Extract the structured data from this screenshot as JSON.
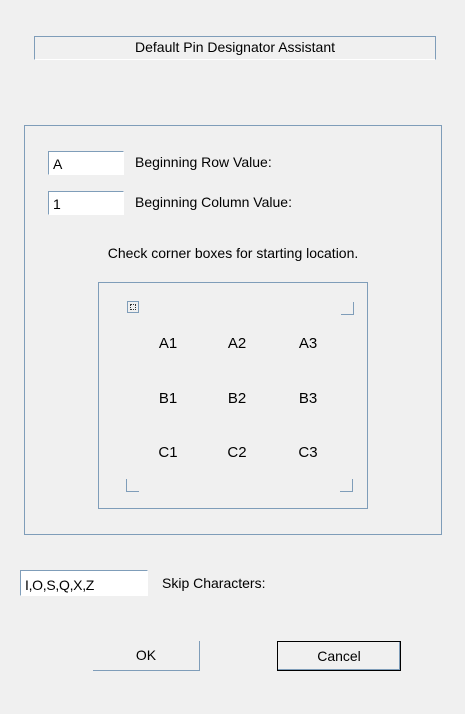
{
  "dialog": {
    "title": "Default Pin Designator Assistant"
  },
  "fields": {
    "row": {
      "label": "Beginning Row Value:",
      "value": "A"
    },
    "column": {
      "label": "Beginning Column Value:",
      "value": "1"
    },
    "skip": {
      "label": "Skip Characters:",
      "value": "I,O,S,Q,X,Z"
    }
  },
  "hint": "Check corner boxes for starting location.",
  "grid": {
    "rows": [
      [
        "A1",
        "A2",
        "A3"
      ],
      [
        "B1",
        "B2",
        "B3"
      ],
      [
        "C1",
        "C2",
        "C3"
      ]
    ]
  },
  "corners": {
    "top_left": {
      "checked": false,
      "focused": true
    },
    "top_right": {
      "checked": false
    },
    "bottom_left": {
      "checked": false
    },
    "bottom_right": {
      "checked": false
    }
  },
  "buttons": {
    "ok": "OK",
    "cancel": "Cancel"
  }
}
